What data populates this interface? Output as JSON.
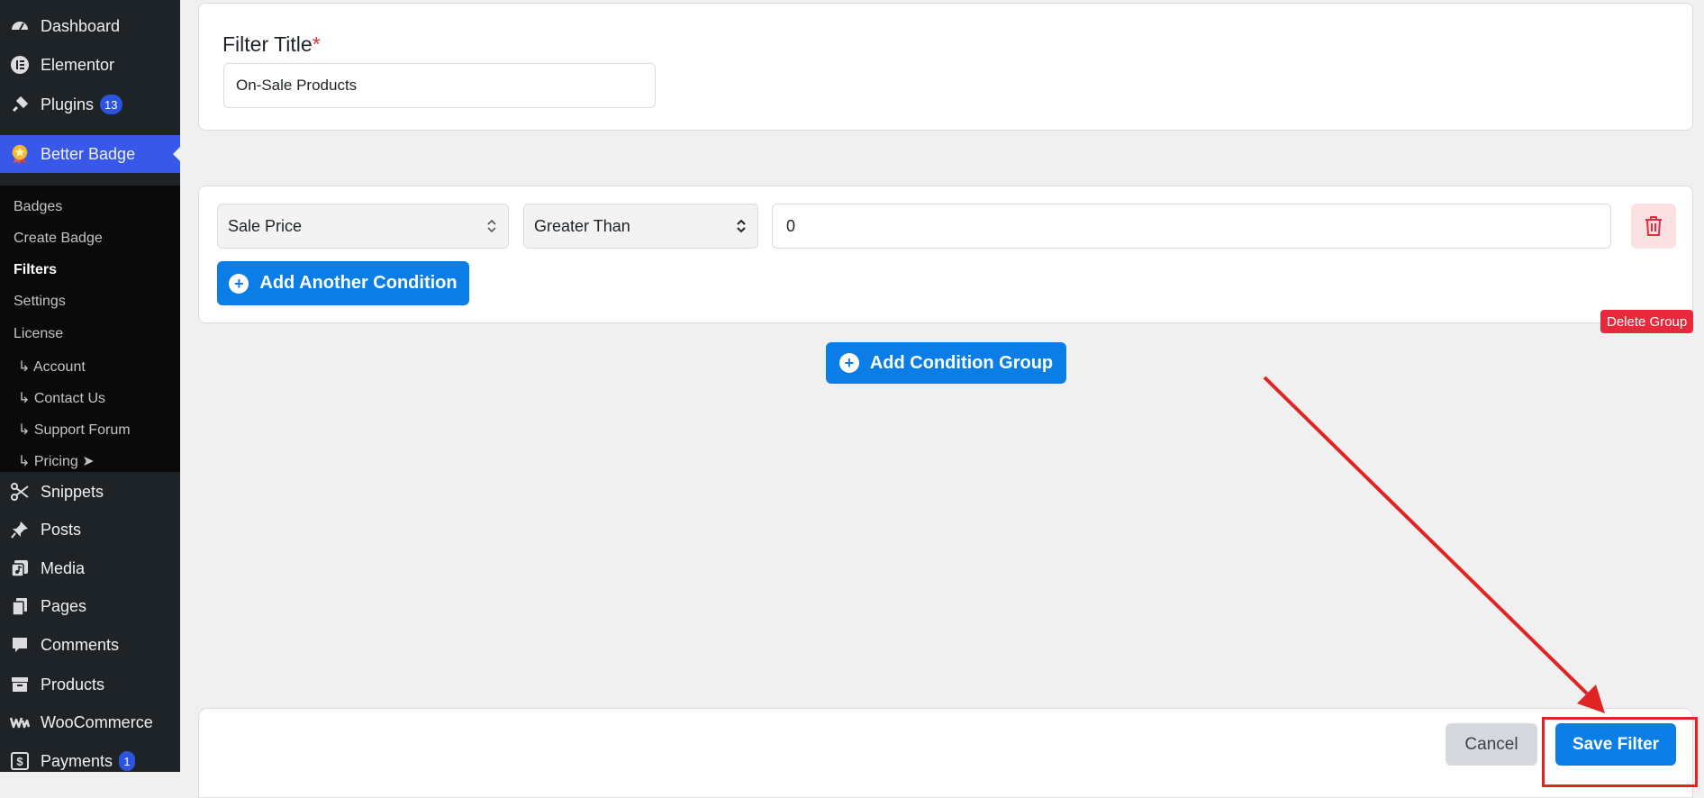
{
  "sidebar": {
    "items": [
      {
        "label": "Dashboard",
        "icon": "dashboard-icon"
      },
      {
        "label": "Elementor",
        "icon": "elementor-icon"
      },
      {
        "label": "Plugins",
        "icon": "plugin-icon",
        "count": "13"
      },
      {
        "label": "Better Badge",
        "icon": "badge-medal-icon"
      },
      {
        "label": "Snippets",
        "icon": "scissors-icon"
      },
      {
        "label": "Posts",
        "icon": "pin-icon"
      },
      {
        "label": "Media",
        "icon": "media-icon"
      },
      {
        "label": "Pages",
        "icon": "pages-icon"
      },
      {
        "label": "Comments",
        "icon": "comment-icon"
      },
      {
        "label": "Products",
        "icon": "archive-icon"
      },
      {
        "label": "WooCommerce",
        "icon": "woocommerce-icon"
      },
      {
        "label": "Payments",
        "icon": "dollar-icon",
        "count": "1"
      }
    ],
    "submenu": [
      {
        "label": "Badges"
      },
      {
        "label": "Create Badge"
      },
      {
        "label": "Filters"
      },
      {
        "label": "Settings"
      },
      {
        "label": "License"
      },
      {
        "label": "↳ Account"
      },
      {
        "label": "↳ Contact Us"
      },
      {
        "label": "↳ Support Forum"
      },
      {
        "label": "↳ Pricing ➤"
      }
    ]
  },
  "form": {
    "title_label": "Filter Title",
    "required_mark": "*",
    "title_value": "On-Sale Products",
    "condition": {
      "field": "Sale Price",
      "operator": "Greater Than",
      "value": "0"
    },
    "add_condition_label": "Add Another Condition",
    "delete_group_label": "Delete Group",
    "add_group_label": "Add Condition Group",
    "plus_glyph": "+"
  },
  "footer": {
    "cancel_label": "Cancel",
    "save_label": "Save Filter"
  },
  "colors": {
    "primary": "#0a7ee6",
    "sidebar_bg": "#1d2327",
    "active_menu": "#3858e9",
    "danger": "#e8283b",
    "annotation": "#e02424"
  }
}
